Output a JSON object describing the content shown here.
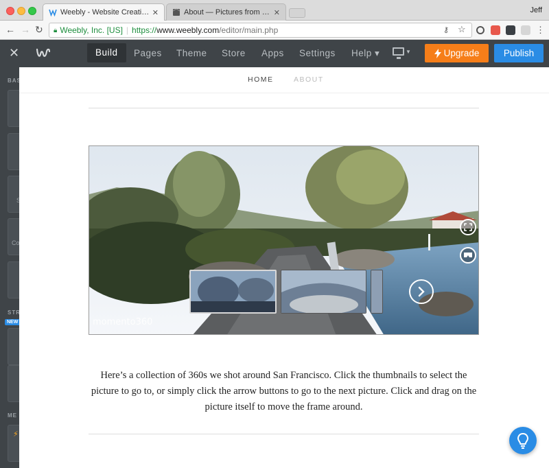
{
  "browser": {
    "tabs": [
      {
        "title": "Weebly - Website Creation Ma",
        "close": "✕"
      },
      {
        "title": "About — Pictures from the Bay",
        "close": "✕"
      }
    ],
    "profile_name": "Jeff",
    "url": {
      "secure_label": "Weebly, Inc. [US]",
      "scheme": "https://",
      "domain": "www.weebly.com",
      "path": "/editor/main.php"
    }
  },
  "editor": {
    "close_icon": "✕",
    "nav": [
      {
        "label": "Build",
        "active": true
      },
      {
        "label": "Pages"
      },
      {
        "label": "Theme"
      },
      {
        "label": "Store"
      },
      {
        "label": "Apps"
      },
      {
        "label": "Settings"
      },
      {
        "label": "Help ▾"
      }
    ],
    "upgrade_label": "Upgrade",
    "publish_label": "Publish"
  },
  "sidebar": {
    "labels": [
      "BAS",
      "STR",
      "ME"
    ],
    "partial_text": [
      "S",
      "Co"
    ],
    "new_badge": "NEW"
  },
  "page": {
    "nav": [
      {
        "label": "HOME",
        "active": true
      },
      {
        "label": "ABOUT"
      }
    ],
    "pano_watermark": "momento360",
    "caption": "Here’s a collection of 360s we shot around San Francisco. Click the thumbnails to select the picture to go to, or simply click the arrow buttons to go to the next picture. Click and drag on the picture itself to move the frame around."
  },
  "colors": {
    "editor_bar": "#3f4448",
    "upgrade": "#f67e19",
    "publish": "#2a8ce5"
  }
}
